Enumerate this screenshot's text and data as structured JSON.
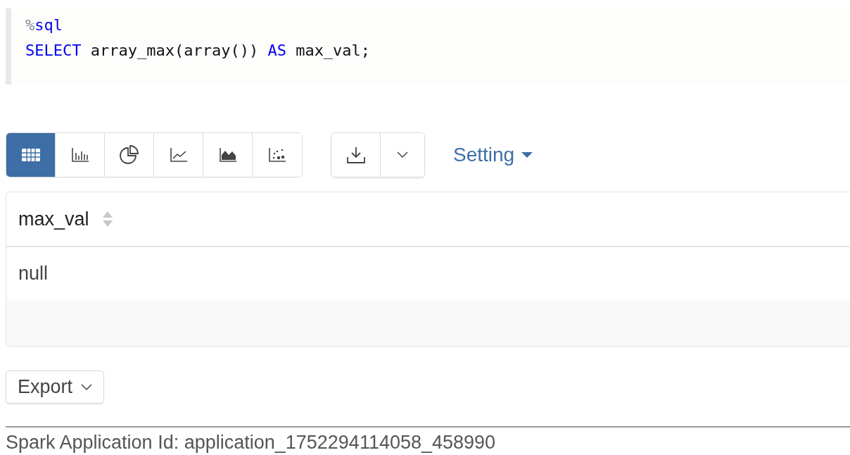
{
  "code": {
    "lines": [
      [
        {
          "kind": "magic",
          "text": "%"
        },
        {
          "kind": "keyword",
          "text": "sql"
        }
      ],
      [
        {
          "kind": "keyword",
          "text": "SELECT"
        },
        {
          "kind": "plain",
          "text": " array_max(array()) "
        },
        {
          "kind": "keyword",
          "text": "AS"
        },
        {
          "kind": "plain",
          "text": " max_val;"
        }
      ]
    ]
  },
  "view_buttons": [
    {
      "kind": "table",
      "selected": true
    },
    {
      "kind": "bar",
      "selected": false
    },
    {
      "kind": "pie",
      "selected": false
    },
    {
      "kind": "line",
      "selected": false
    },
    {
      "kind": "area",
      "selected": false
    },
    {
      "kind": "scatter",
      "selected": false
    }
  ],
  "setting": {
    "label": "Setting"
  },
  "table": {
    "columns": [
      "max_val"
    ],
    "rows": [
      [
        "null"
      ]
    ]
  },
  "export": {
    "label": "Export"
  },
  "footer": "Spark Application Id: application_1752294114058_458990"
}
